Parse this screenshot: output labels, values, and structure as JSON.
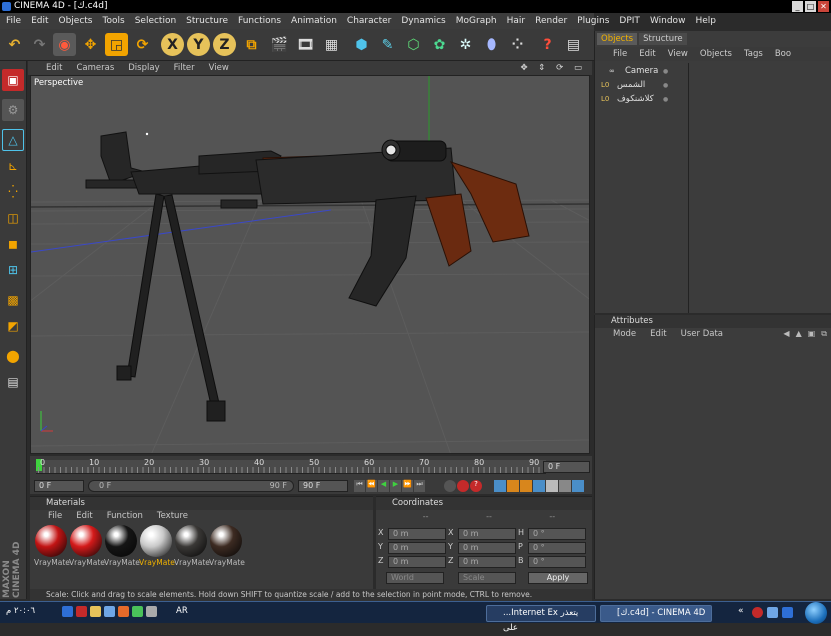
{
  "window": {
    "title": "CINEMA 4D - [ك.c4d]",
    "controls": [
      "_",
      "□",
      "✕"
    ]
  },
  "menubar": {
    "items": [
      "File",
      "Edit",
      "Objects",
      "Tools",
      "Selection",
      "Structure",
      "Functions",
      "Animation",
      "Character",
      "Dynamics",
      "MoGraph",
      "Hair",
      "Render",
      "Plugins",
      "DPIT",
      "Window",
      "Help"
    ]
  },
  "toolbar": {
    "axis_x": "X",
    "axis_y": "Y",
    "axis_z": "Z"
  },
  "viewport": {
    "menu": [
      "Edit",
      "Cameras",
      "Display",
      "Filter",
      "View"
    ],
    "label": "Perspective"
  },
  "timeline": {
    "ticks": [
      "0",
      "10",
      "20",
      "30",
      "40",
      "50",
      "60",
      "70",
      "80",
      "90"
    ],
    "current_frame": "0 F",
    "start_field": "0 F",
    "range_start": "0 F",
    "range_end": "90 F",
    "end_field": "90 F"
  },
  "materials": {
    "title": "Materials",
    "menu": [
      "File",
      "Edit",
      "Function",
      "Texture"
    ],
    "items": [
      {
        "label": "VrayMate",
        "color": "#c21414",
        "selected": false
      },
      {
        "label": "VrayMate",
        "color": "#d41a1a",
        "selected": false
      },
      {
        "label": "VrayMate",
        "color": "#151515",
        "selected": false
      },
      {
        "label": "VrayMate",
        "color": "#c9c9c9",
        "selected": true
      },
      {
        "label": "VrayMate",
        "color": "#3a3836",
        "selected": false
      },
      {
        "label": "VrayMate",
        "color": "#3d2b22",
        "selected": false
      }
    ]
  },
  "coordinates": {
    "title": "Coordinates",
    "columns": [
      "--",
      "--",
      "--"
    ],
    "rows": [
      {
        "l1": "X",
        "v1": "0 m",
        "l2": "X",
        "v2": "0 m",
        "l3": "H",
        "v3": "0 °"
      },
      {
        "l1": "Y",
        "v1": "0 m",
        "l2": "Y",
        "v2": "0 m",
        "l3": "P",
        "v3": "0 °"
      },
      {
        "l1": "Z",
        "v1": "0 m",
        "l2": "Z",
        "v2": "0 m",
        "l3": "B",
        "v3": "0 °"
      }
    ],
    "mode_select": "World",
    "scale_select": "Scale",
    "apply_label": "Apply"
  },
  "status": {
    "text": "Scale: Click and drag to scale elements. Hold down SHIFT to quantize scale / add to the selection in point mode, CTRL to remove."
  },
  "objects_panel": {
    "tabs": [
      "Objects",
      "Structure"
    ],
    "menu": [
      "File",
      "Edit",
      "View",
      "Objects",
      "Tags",
      "Boo"
    ],
    "objects": [
      {
        "name": "Camera",
        "icon": "camera-icon"
      },
      {
        "name": "الشمس",
        "icon": "null-object-icon"
      },
      {
        "name": "كلاشنكوف",
        "icon": "null-object-icon"
      }
    ]
  },
  "attributes_panel": {
    "title": "Attributes",
    "menu": [
      "Mode",
      "Edit",
      "User Data"
    ]
  },
  "taskbar": {
    "clock": "٢٠:٠٦ م",
    "lang": "AR",
    "items": [
      "...Internet Ex يتعذر على",
      "[ك.c4d] - CINEMA 4D"
    ],
    "tray_chevron": "«"
  },
  "colors": {
    "accent": "#f2b300",
    "viewport_bg": "#545454",
    "panel_bg": "#3a3a3a"
  }
}
